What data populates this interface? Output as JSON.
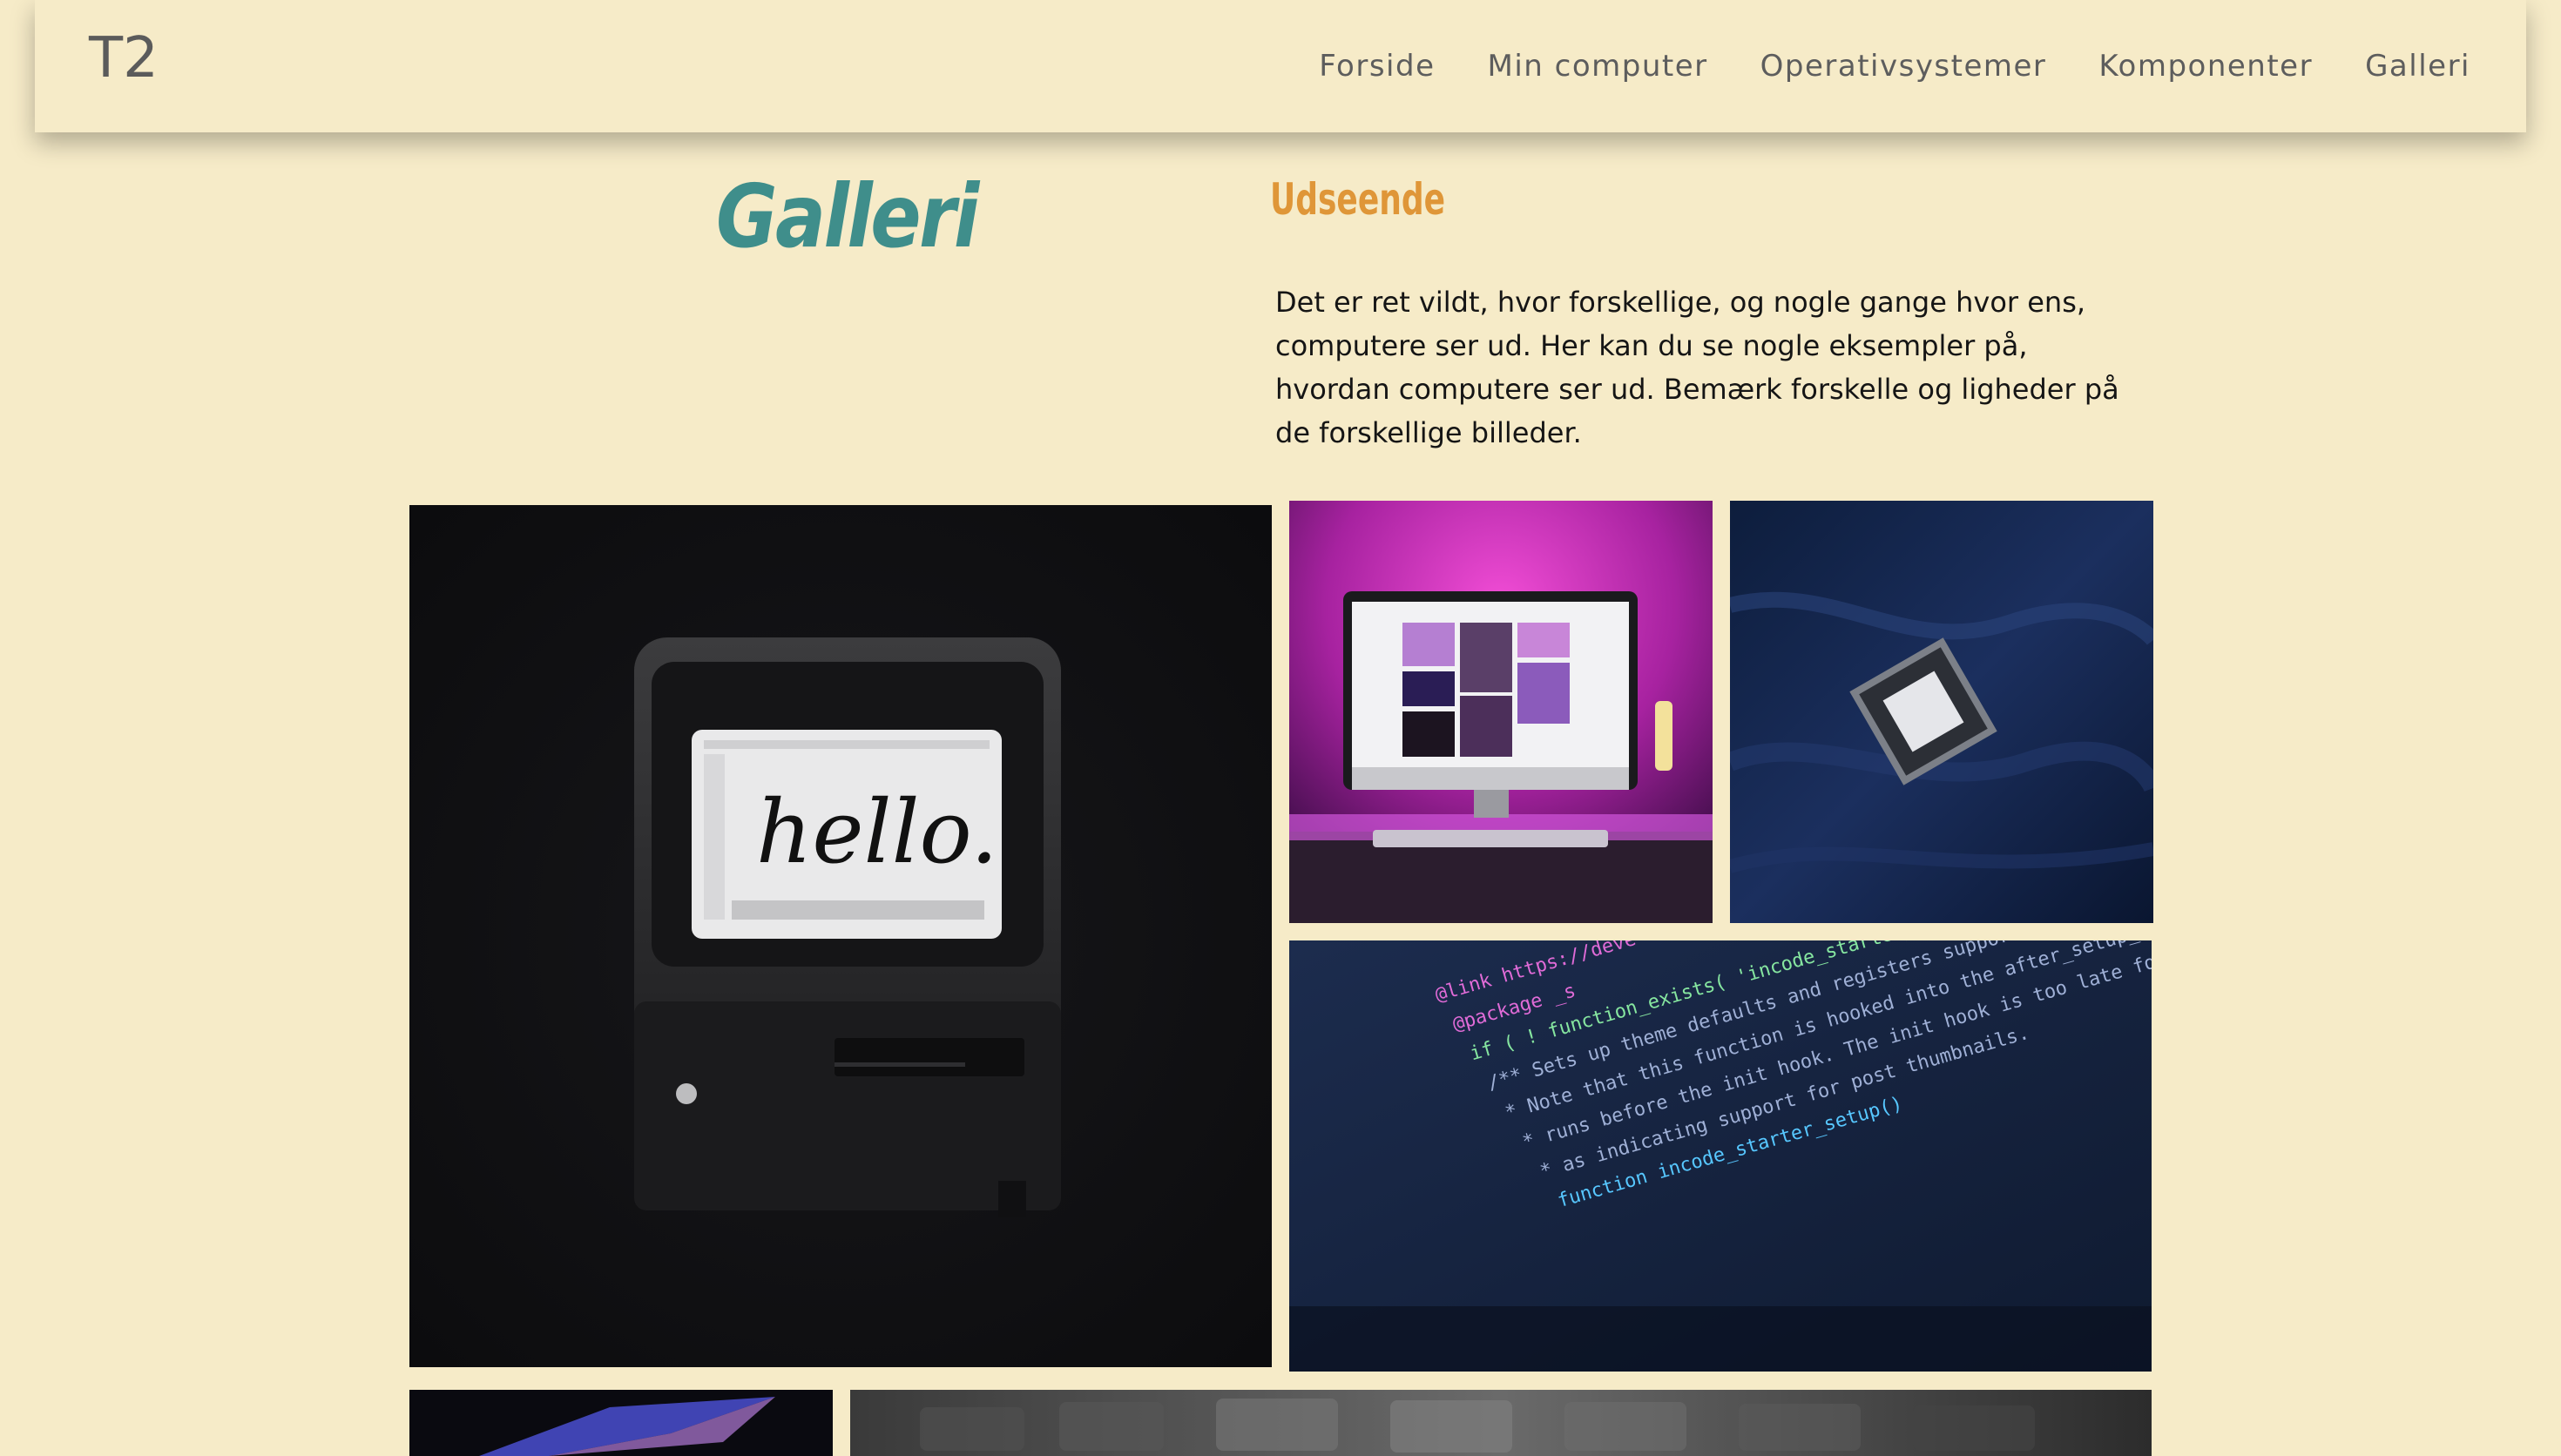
{
  "header": {
    "logo": "T2",
    "nav": [
      "Forside",
      "Min computer",
      "Operativsystemer",
      "Komponenter",
      "Galleri"
    ]
  },
  "main": {
    "title": "Galleri",
    "subtitle": "Udseende",
    "intro": "Det er ret vildt, hvor forskellige, og nogle gange hvor ens, computere ser ud. Her kan du se nogle eksempler på, hvordan computere ser ud. Bemærk forskelle og ligheder på de forskellige billeder.",
    "hello_text": "hello.",
    "code_lines": [
      "@link https://deve",
      "@package _s",
      "if ( ! function_exists( 'incode_starter_setup' ) ) :",
      "/** Sets up theme defaults and registers support for various WordPress",
      "* Note that this function is hooked into the after_setup_theme hook",
      "* runs before the init hook. The init hook is too late for some",
      "* as indicating support for post thumbnails.",
      "function incode_starter_setup()"
    ]
  },
  "colors": {
    "background": "#f6ebc8",
    "title": "#3f8e8b",
    "subtitle": "#df9638",
    "nav_text": "#5d5d5d"
  }
}
